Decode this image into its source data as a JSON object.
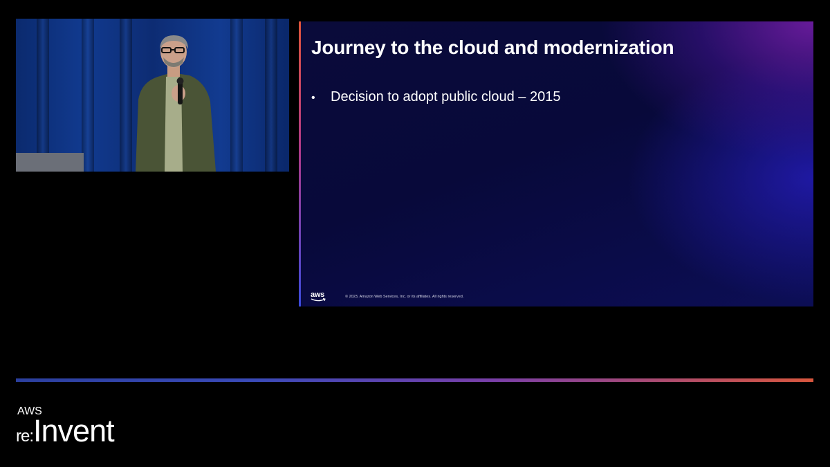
{
  "slide": {
    "title": "Journey to the cloud and modernization",
    "bullets": [
      {
        "text": "Decision to adopt public cloud – 2015"
      }
    ],
    "bullet_glyph": "•",
    "footer": {
      "logo_text": "aws",
      "copyright": "© 2023, Amazon Web Services, Inc. or its affiliates. All rights reserved."
    },
    "accent_colors": [
      "#e0553a",
      "#b03a8a",
      "#3b4bdc"
    ]
  },
  "brand": {
    "aws": "AWS",
    "re": "re:",
    "invent": "Invent"
  },
  "colors": {
    "background": "#000000",
    "rule_start": "#2b3f9e",
    "rule_end": "#d9573e"
  }
}
